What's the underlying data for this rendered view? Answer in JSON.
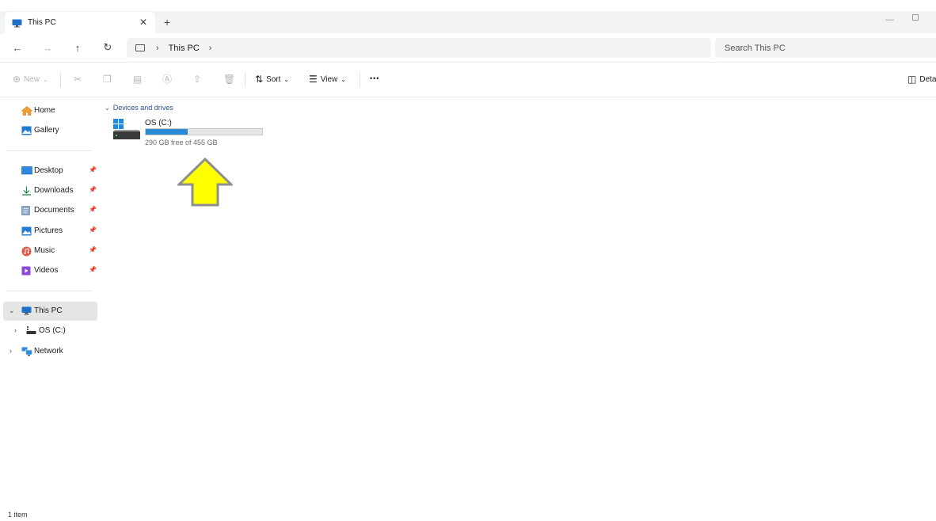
{
  "tab": {
    "title": "This PC",
    "close_glyph": "✕",
    "new_tab_glyph": "+"
  },
  "window_controls": {
    "minimize_glyph": "—"
  },
  "nav": {
    "back": "←",
    "forward": "→",
    "up": "↑",
    "refresh": "↻"
  },
  "address": {
    "separator": "›",
    "crumbs": [
      "This PC"
    ],
    "trailing_separator": "›"
  },
  "search": {
    "placeholder": "Search This PC"
  },
  "commandbar": {
    "new_label": "New",
    "sort_label": "Sort",
    "view_label": "View",
    "more_glyph": "•••",
    "details_label": "Details"
  },
  "sidebar": {
    "quick": [
      {
        "label": "Home",
        "icon": "home-icon"
      },
      {
        "label": "Gallery",
        "icon": "gallery-icon"
      }
    ],
    "pinned": [
      {
        "label": "Desktop",
        "icon": "desktop-icon"
      },
      {
        "label": "Downloads",
        "icon": "downloads-icon"
      },
      {
        "label": "Documents",
        "icon": "documents-icon"
      },
      {
        "label": "Pictures",
        "icon": "pictures-icon"
      },
      {
        "label": "Music",
        "icon": "music-icon"
      },
      {
        "label": "Videos",
        "icon": "videos-icon"
      }
    ],
    "tree": [
      {
        "label": "This PC",
        "icon": "this-pc-icon",
        "expanded": true,
        "selected": true
      },
      {
        "label": "OS (C:)",
        "icon": "drive-icon",
        "expanded": false
      },
      {
        "label": "Network",
        "icon": "network-icon",
        "expanded": false
      }
    ]
  },
  "content": {
    "group_label": "Devices and drives",
    "drive": {
      "name": "OS (C:)",
      "free_text": "290 GB free of 455 GB",
      "used_fraction": 0.363
    }
  },
  "status": {
    "item_count": "1 item"
  },
  "colors": {
    "accent": "#2a8ad4",
    "group_header": "#2b4f8e",
    "selection_bg": "#e5e5e5",
    "annotation_arrow": "#ffff00"
  }
}
